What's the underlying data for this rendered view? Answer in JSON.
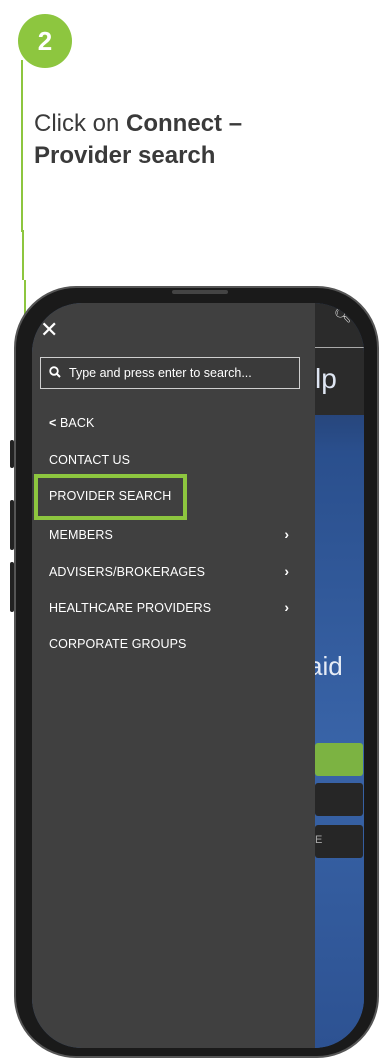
{
  "step": {
    "number": "2"
  },
  "instruction": {
    "prefix": "Click on ",
    "bold": "Connect – Provider search"
  },
  "menu": {
    "close_icon": "close-icon",
    "search_placeholder": "Type and press enter to search...",
    "back_label": "BACK",
    "items": [
      {
        "label": "CONTACT US",
        "has_submenu": false
      },
      {
        "label": "PROVIDER SEARCH",
        "has_submenu": false,
        "highlighted": true
      },
      {
        "label": "MEMBERS",
        "has_submenu": true
      },
      {
        "label": "ADVISERS/BROKERAGES",
        "has_submenu": true
      },
      {
        "label": "HEALTHCARE PROVIDERS",
        "has_submenu": true
      },
      {
        "label": "CORPORATE GROUPS",
        "has_submenu": false
      }
    ]
  },
  "background_page": {
    "partial_title": "lp",
    "partial_heading": "aid",
    "partial_button": "E"
  },
  "colors": {
    "accent": "#8dc63f",
    "menu_bg": "#404040"
  }
}
